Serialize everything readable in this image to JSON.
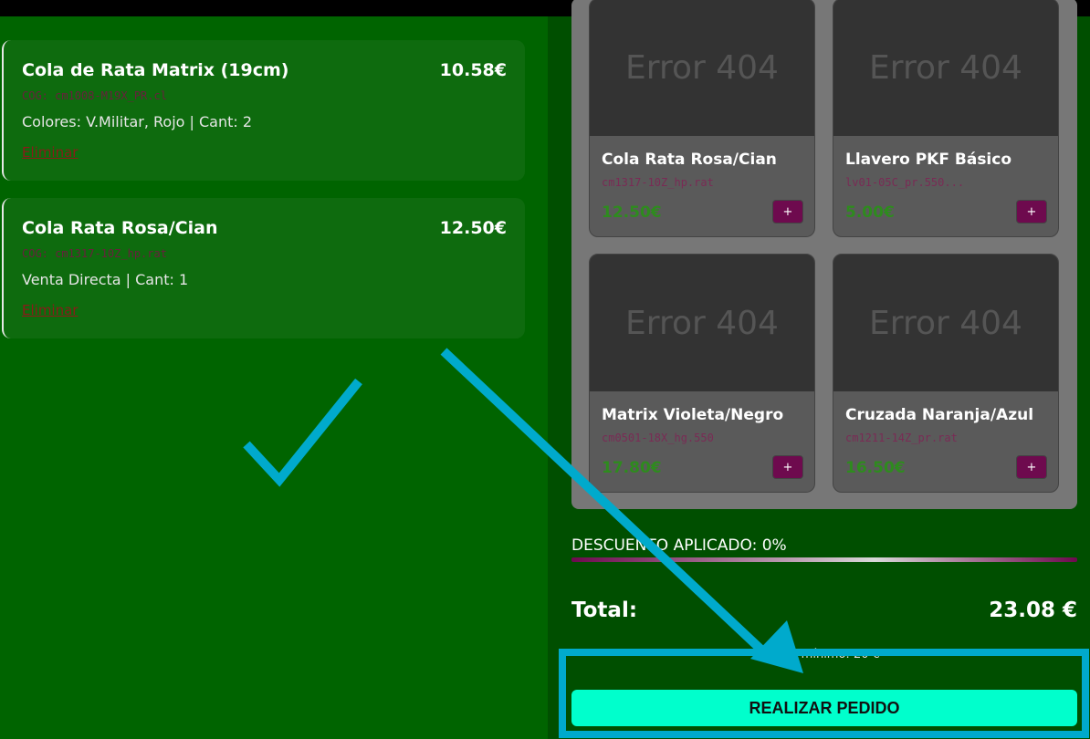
{
  "cart": {
    "items": [
      {
        "name": "Cola de Rata Matrix (19cm)",
        "price": "10.58€",
        "cog": "COG: cm1008-M19X_PR.cl",
        "meta": "Colores: V.Militar, Rojo | Cant: 2",
        "remove": "Eliminar"
      },
      {
        "name": "Cola Rata Rosa/Cian",
        "price": "12.50€",
        "cog": "COG: cm1317-10Z_hp.rat",
        "meta": "Venta Directa | Cant: 1",
        "remove": "Eliminar"
      }
    ]
  },
  "products": [
    {
      "image_text": "Error 404",
      "name": "Cola Rata Rosa/Cian",
      "code": "cm1317-10Z_hp.rat",
      "price": "12.50€",
      "add": "+"
    },
    {
      "image_text": "Error 404",
      "name": "Llavero PKF Básico",
      "code": "lv01-05C_pr.550...",
      "price": "5.00€",
      "add": "+"
    },
    {
      "image_text": "Error 404",
      "name": "Matrix Violeta/Negro",
      "code": "cm0501-18X_hg.550",
      "price": "17.80€",
      "add": "+"
    },
    {
      "image_text": "Error 404",
      "name": "Cruzada Naranja/Azul",
      "code": "cm1211-14Z_pr.rat",
      "price": "16.50€",
      "add": "+"
    }
  ],
  "summary": {
    "discount": "DESCUENTO APLICADO: 0%",
    "total_label": "Total:",
    "total_value": "23.08 €",
    "minimum": "Pedido mínimo: 20 €",
    "order_button": "REALIZAR PEDIDO"
  },
  "colors": {
    "background": "#006400",
    "panel": "#004f00",
    "accent_button": "#00ffcc",
    "annotation": "#00aacc"
  }
}
